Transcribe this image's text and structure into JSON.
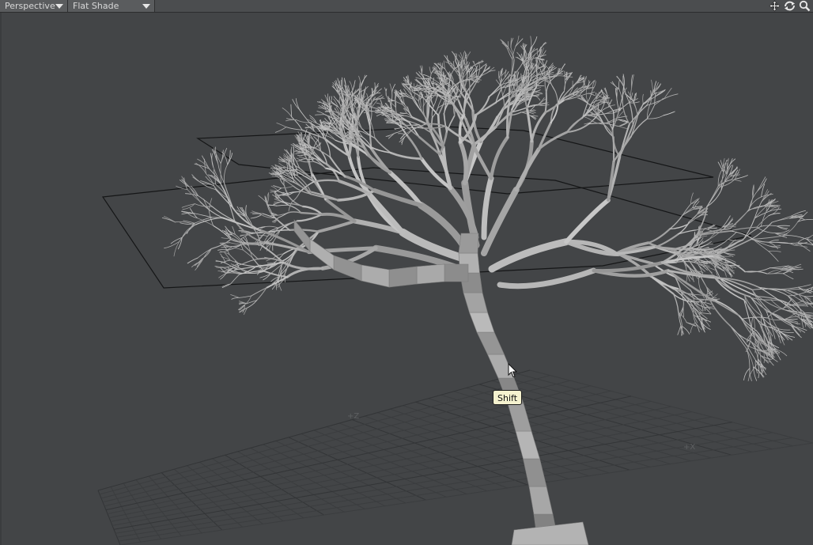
{
  "toolbar": {
    "view_type": "Perspective",
    "shading_mode": "Flat Shade",
    "icons": [
      "move-view-icon",
      "rotate-view-icon",
      "zoom-view-icon"
    ]
  },
  "viewport": {
    "axis_labels": {
      "z": "+Z",
      "x": "+X"
    },
    "tooltip": "Shift",
    "background_color": "#434547",
    "grid_color": "#3a3c3e",
    "mesh_color": "#aaaaaa"
  }
}
